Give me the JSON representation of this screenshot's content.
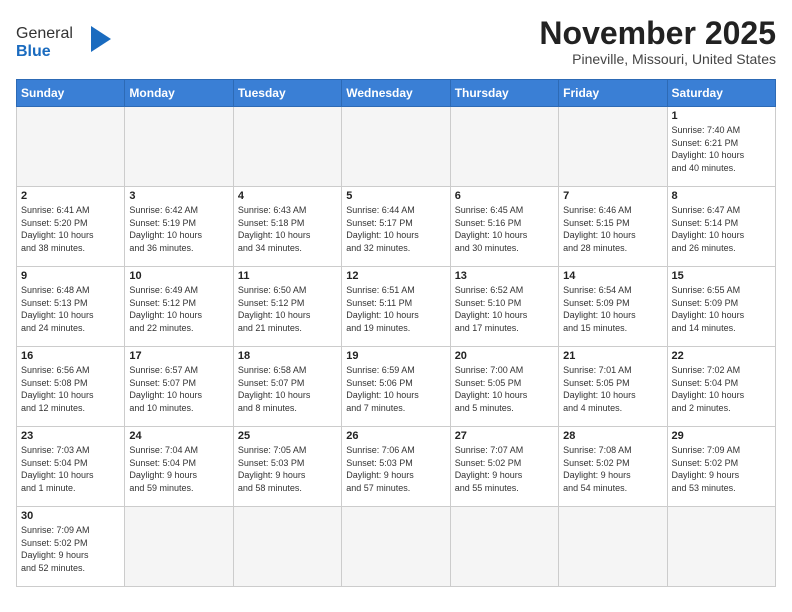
{
  "header": {
    "logo_general": "General",
    "logo_blue": "Blue",
    "month": "November 2025",
    "location": "Pineville, Missouri, United States"
  },
  "weekdays": [
    "Sunday",
    "Monday",
    "Tuesday",
    "Wednesday",
    "Thursday",
    "Friday",
    "Saturday"
  ],
  "weeks": [
    [
      {
        "day": "",
        "info": ""
      },
      {
        "day": "",
        "info": ""
      },
      {
        "day": "",
        "info": ""
      },
      {
        "day": "",
        "info": ""
      },
      {
        "day": "",
        "info": ""
      },
      {
        "day": "",
        "info": ""
      },
      {
        "day": "1",
        "info": "Sunrise: 7:40 AM\nSunset: 6:21 PM\nDaylight: 10 hours\nand 40 minutes."
      }
    ],
    [
      {
        "day": "2",
        "info": "Sunrise: 6:41 AM\nSunset: 5:20 PM\nDaylight: 10 hours\nand 38 minutes."
      },
      {
        "day": "3",
        "info": "Sunrise: 6:42 AM\nSunset: 5:19 PM\nDaylight: 10 hours\nand 36 minutes."
      },
      {
        "day": "4",
        "info": "Sunrise: 6:43 AM\nSunset: 5:18 PM\nDaylight: 10 hours\nand 34 minutes."
      },
      {
        "day": "5",
        "info": "Sunrise: 6:44 AM\nSunset: 5:17 PM\nDaylight: 10 hours\nand 32 minutes."
      },
      {
        "day": "6",
        "info": "Sunrise: 6:45 AM\nSunset: 5:16 PM\nDaylight: 10 hours\nand 30 minutes."
      },
      {
        "day": "7",
        "info": "Sunrise: 6:46 AM\nSunset: 5:15 PM\nDaylight: 10 hours\nand 28 minutes."
      },
      {
        "day": "8",
        "info": "Sunrise: 6:47 AM\nSunset: 5:14 PM\nDaylight: 10 hours\nand 26 minutes."
      }
    ],
    [
      {
        "day": "9",
        "info": "Sunrise: 6:48 AM\nSunset: 5:13 PM\nDaylight: 10 hours\nand 24 minutes."
      },
      {
        "day": "10",
        "info": "Sunrise: 6:49 AM\nSunset: 5:12 PM\nDaylight: 10 hours\nand 22 minutes."
      },
      {
        "day": "11",
        "info": "Sunrise: 6:50 AM\nSunset: 5:12 PM\nDaylight: 10 hours\nand 21 minutes."
      },
      {
        "day": "12",
        "info": "Sunrise: 6:51 AM\nSunset: 5:11 PM\nDaylight: 10 hours\nand 19 minutes."
      },
      {
        "day": "13",
        "info": "Sunrise: 6:52 AM\nSunset: 5:10 PM\nDaylight: 10 hours\nand 17 minutes."
      },
      {
        "day": "14",
        "info": "Sunrise: 6:54 AM\nSunset: 5:09 PM\nDaylight: 10 hours\nand 15 minutes."
      },
      {
        "day": "15",
        "info": "Sunrise: 6:55 AM\nSunset: 5:09 PM\nDaylight: 10 hours\nand 14 minutes."
      }
    ],
    [
      {
        "day": "16",
        "info": "Sunrise: 6:56 AM\nSunset: 5:08 PM\nDaylight: 10 hours\nand 12 minutes."
      },
      {
        "day": "17",
        "info": "Sunrise: 6:57 AM\nSunset: 5:07 PM\nDaylight: 10 hours\nand 10 minutes."
      },
      {
        "day": "18",
        "info": "Sunrise: 6:58 AM\nSunset: 5:07 PM\nDaylight: 10 hours\nand 8 minutes."
      },
      {
        "day": "19",
        "info": "Sunrise: 6:59 AM\nSunset: 5:06 PM\nDaylight: 10 hours\nand 7 minutes."
      },
      {
        "day": "20",
        "info": "Sunrise: 7:00 AM\nSunset: 5:05 PM\nDaylight: 10 hours\nand 5 minutes."
      },
      {
        "day": "21",
        "info": "Sunrise: 7:01 AM\nSunset: 5:05 PM\nDaylight: 10 hours\nand 4 minutes."
      },
      {
        "day": "22",
        "info": "Sunrise: 7:02 AM\nSunset: 5:04 PM\nDaylight: 10 hours\nand 2 minutes."
      }
    ],
    [
      {
        "day": "23",
        "info": "Sunrise: 7:03 AM\nSunset: 5:04 PM\nDaylight: 10 hours\nand 1 minute."
      },
      {
        "day": "24",
        "info": "Sunrise: 7:04 AM\nSunset: 5:04 PM\nDaylight: 9 hours\nand 59 minutes."
      },
      {
        "day": "25",
        "info": "Sunrise: 7:05 AM\nSunset: 5:03 PM\nDaylight: 9 hours\nand 58 minutes."
      },
      {
        "day": "26",
        "info": "Sunrise: 7:06 AM\nSunset: 5:03 PM\nDaylight: 9 hours\nand 57 minutes."
      },
      {
        "day": "27",
        "info": "Sunrise: 7:07 AM\nSunset: 5:02 PM\nDaylight: 9 hours\nand 55 minutes."
      },
      {
        "day": "28",
        "info": "Sunrise: 7:08 AM\nSunset: 5:02 PM\nDaylight: 9 hours\nand 54 minutes."
      },
      {
        "day": "29",
        "info": "Sunrise: 7:09 AM\nSunset: 5:02 PM\nDaylight: 9 hours\nand 53 minutes."
      }
    ],
    [
      {
        "day": "30",
        "info": "Sunrise: 7:09 AM\nSunset: 5:02 PM\nDaylight: 9 hours\nand 52 minutes."
      },
      {
        "day": "",
        "info": ""
      },
      {
        "day": "",
        "info": ""
      },
      {
        "day": "",
        "info": ""
      },
      {
        "day": "",
        "info": ""
      },
      {
        "day": "",
        "info": ""
      },
      {
        "day": "",
        "info": ""
      }
    ]
  ]
}
